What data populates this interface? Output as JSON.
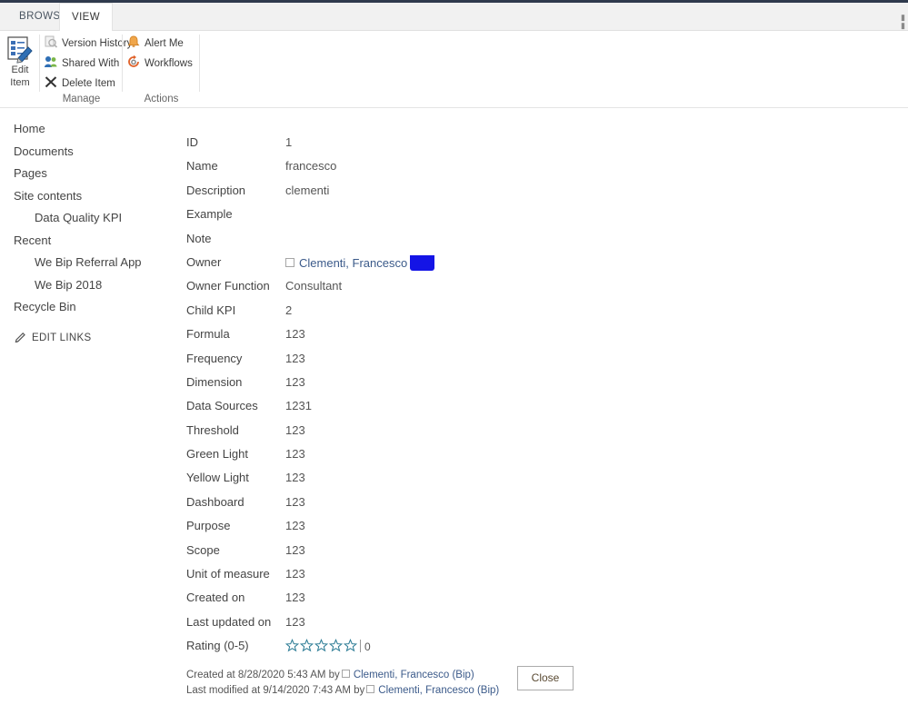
{
  "window": {
    "tabs": [
      {
        "id": "browse",
        "label": "BROWSE",
        "active": false
      },
      {
        "id": "view",
        "label": "VIEW",
        "active": true
      }
    ]
  },
  "ribbon": {
    "edit_item": {
      "line1": "Edit",
      "line2": "Item",
      "icon": "edit-item-icon"
    },
    "groups": [
      {
        "id": "manage",
        "label": "Manage",
        "items": [
          {
            "id": "version-history",
            "label": "Version History",
            "icon": "version-history-icon",
            "disabled": true
          },
          {
            "id": "shared-with",
            "label": "Shared With",
            "icon": "shared-with-icon",
            "disabled": false
          },
          {
            "id": "delete-item",
            "label": "Delete Item",
            "icon": "delete-item-icon",
            "disabled": false
          }
        ]
      },
      {
        "id": "actions",
        "label": "Actions",
        "items": [
          {
            "id": "alert-me",
            "label": "Alert Me",
            "icon": "alert-bell-icon",
            "disabled": false
          },
          {
            "id": "workflows",
            "label": "Workflows",
            "icon": "workflows-icon",
            "disabled": false
          }
        ]
      }
    ]
  },
  "sidebar": {
    "items": [
      {
        "id": "home",
        "label": "Home",
        "level": 1
      },
      {
        "id": "documents",
        "label": "Documents",
        "level": 1
      },
      {
        "id": "pages",
        "label": "Pages",
        "level": 1
      },
      {
        "id": "site-contents",
        "label": "Site contents",
        "level": 1
      },
      {
        "id": "data-quality-kpi",
        "label": "Data Quality KPI",
        "level": 2
      },
      {
        "id": "recent",
        "label": "Recent",
        "level": 1
      },
      {
        "id": "we-bip-referral",
        "label": "We Bip Referral App",
        "level": 2
      },
      {
        "id": "we-bip-2018",
        "label": "We Bip 2018",
        "level": 2
      },
      {
        "id": "recycle-bin",
        "label": "Recycle Bin",
        "level": 1
      }
    ],
    "edit_links": "EDIT LINKS"
  },
  "form": {
    "fields": [
      {
        "id": "id",
        "label": "ID",
        "value": "1"
      },
      {
        "id": "name",
        "label": "Name",
        "value": "francesco"
      },
      {
        "id": "description",
        "label": "Description",
        "value": "clementi"
      },
      {
        "id": "example",
        "label": "Example",
        "value": ""
      },
      {
        "id": "note",
        "label": "Note",
        "value": ""
      },
      {
        "id": "owner",
        "label": "Owner",
        "value": "",
        "type": "person",
        "person_name": "Clementi, Francesco"
      },
      {
        "id": "owner-function",
        "label": "Owner Function",
        "value": "Consultant"
      },
      {
        "id": "child-kpi",
        "label": "Child KPI",
        "value": "2"
      },
      {
        "id": "formula",
        "label": "Formula",
        "value": "123"
      },
      {
        "id": "frequency",
        "label": "Frequency",
        "value": "123"
      },
      {
        "id": "dimension",
        "label": "Dimension",
        "value": "123"
      },
      {
        "id": "data-sources",
        "label": "Data Sources",
        "value": "1231"
      },
      {
        "id": "threshold",
        "label": "Threshold",
        "value": "123"
      },
      {
        "id": "green-light",
        "label": "Green Light",
        "value": "123"
      },
      {
        "id": "yellow-light",
        "label": "Yellow Light",
        "value": "123"
      },
      {
        "id": "dashboard",
        "label": "Dashboard",
        "value": "123"
      },
      {
        "id": "purpose",
        "label": "Purpose",
        "value": "123"
      },
      {
        "id": "scope",
        "label": "Scope",
        "value": "123"
      },
      {
        "id": "unit-of-measure",
        "label": "Unit of measure",
        "value": "123"
      },
      {
        "id": "created-on",
        "label": "Created on",
        "value": "123"
      },
      {
        "id": "last-updated-on",
        "label": "Last updated on",
        "value": "123"
      },
      {
        "id": "rating",
        "label": "Rating (0-5)",
        "value": "",
        "type": "rating",
        "rating_value": "0",
        "stars_total": 5,
        "stars_filled": 0
      }
    ]
  },
  "footer": {
    "created_prefix": "Created at 8/28/2020 5:43 AM",
    "created_by_label": "by",
    "created_by_name": "Clementi, Francesco (Bip)",
    "modified_prefix": "Last modified at 9/14/2020 7:43 AM",
    "modified_by_label": "by",
    "modified_by_name": "Clementi, Francesco (Bip)",
    "close_button": "Close"
  },
  "colors": {
    "suite_bar": "#2f3a4d",
    "accent_blue": "#1414e6",
    "star": "#2e7d96",
    "person_link": "#3b5a8a",
    "alert_orange": "#e8912a"
  }
}
